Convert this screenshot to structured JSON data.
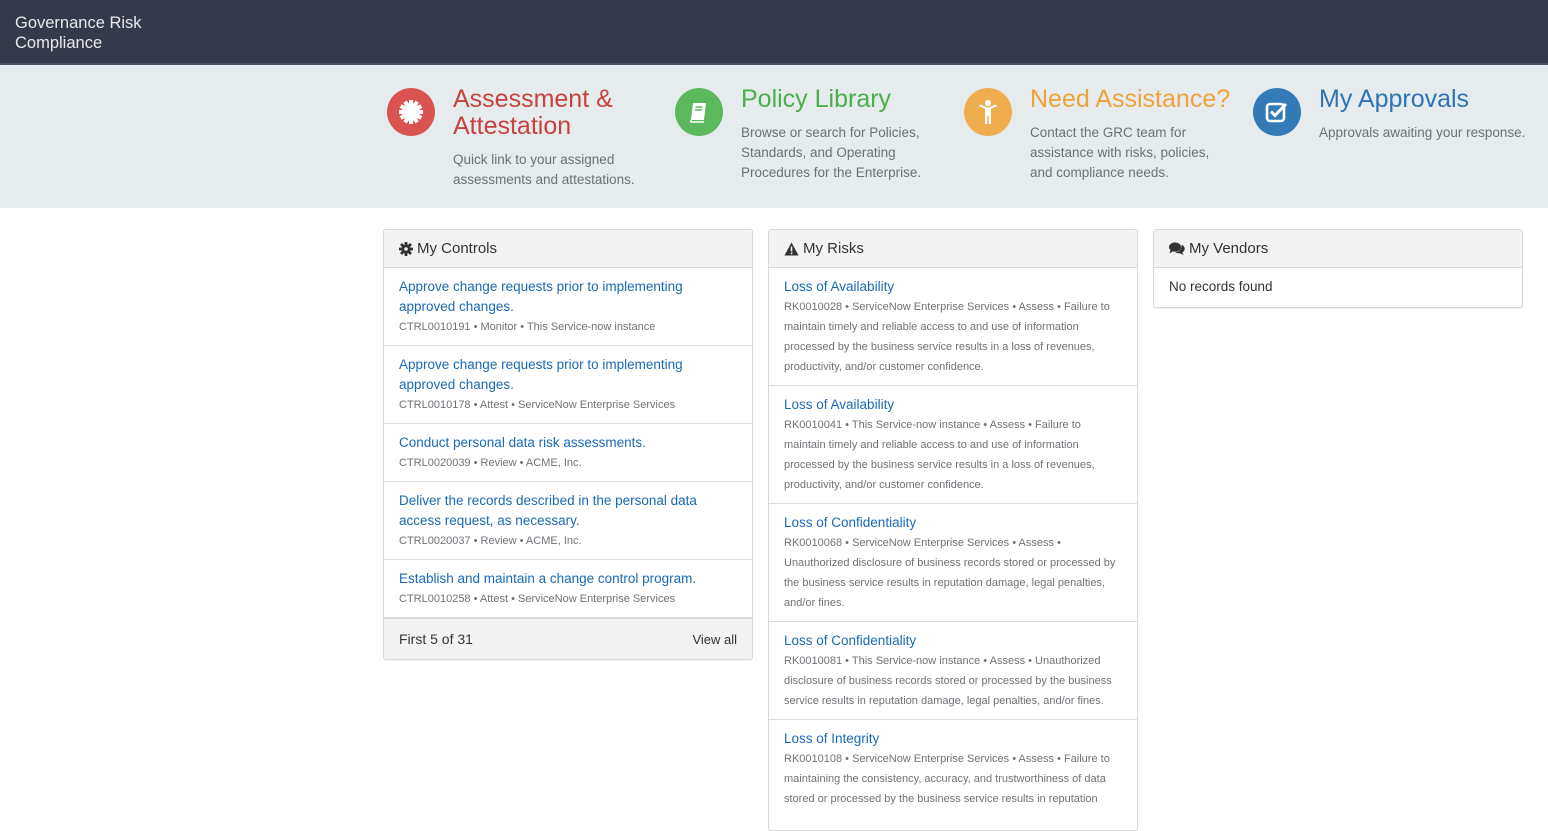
{
  "app": {
    "title": "Governance Risk Compliance"
  },
  "tiles": [
    {
      "title": "Assessment & Attestation",
      "description": "Quick link to your assigned assessments and attestations.",
      "icon": "badge-icon",
      "color": "#d9534f",
      "title_color": "#c9413d"
    },
    {
      "title": "Policy Library",
      "description": "Browse or search for Policies, Standards, and Operating Procedures for the Enterprise.",
      "icon": "book-icon",
      "color": "#5cb85c",
      "title_color": "#4cae4c"
    },
    {
      "title": "Need Assistance?",
      "description": "Contact the GRC team for assistance with risks, policies, and compliance needs.",
      "icon": "person-icon",
      "color": "#f0ad4e",
      "title_color": "#eea23b"
    },
    {
      "title": "My Approvals",
      "description": "Approvals awaiting your response.",
      "icon": "checkbox-icon",
      "color": "#337ab7",
      "title_color": "#2e73b8"
    }
  ],
  "controls": {
    "title": "My Controls",
    "items": [
      {
        "title": "Approve change requests prior to implementing approved changes.",
        "meta": "CTRL0010191 • Monitor • This Service-now instance"
      },
      {
        "title": "Approve change requests prior to implementing approved changes.",
        "meta": "CTRL0010178 • Attest • ServiceNow Enterprise Services"
      },
      {
        "title": "Conduct personal data risk assessments.",
        "meta": "CTRL0020039 • Review • ACME, Inc."
      },
      {
        "title": "Deliver the records described in the personal data access request, as necessary.",
        "meta": "CTRL0020037 • Review • ACME, Inc."
      },
      {
        "title": "Establish and maintain a change control program.",
        "meta": "CTRL0010258 • Attest • ServiceNow Enterprise Services"
      }
    ],
    "footer_count": "First 5 of 31",
    "view_all": "View all"
  },
  "risks": {
    "title": "My Risks",
    "items": [
      {
        "title": "Loss of Availability",
        "meta": "RK0010028 • ServiceNow Enterprise Services • Assess • Failure to maintain timely and reliable access to and use of information processed by the business service results in a loss of revenues, productivity, and/or customer confidence."
      },
      {
        "title": "Loss of Availability",
        "meta": "RK0010041 • This Service-now instance • Assess • Failure to maintain timely and reliable access to and use of information processed by the business service results in a loss of revenues, productivity, and/or customer confidence."
      },
      {
        "title": "Loss of Confidentiality",
        "meta": "RK0010068 • ServiceNow Enterprise Services • Assess • Unauthorized disclosure of business records stored or processed by the business service results in reputation damage, legal penalties, and/or fines."
      },
      {
        "title": "Loss of Confidentiality",
        "meta": "RK0010081 • This Service-now instance • Assess • Unauthorized disclosure of business records stored or processed by the business service results in reputation damage, legal penalties, and/or fines."
      },
      {
        "title": "Loss of Integrity",
        "meta": "RK0010108 • ServiceNow Enterprise Services • Assess • Failure to maintaining the consistency, accuracy, and trustworthiness of data stored or processed by the business service results in reputation"
      }
    ]
  },
  "vendors": {
    "title": "My Vendors",
    "empty": "No records found"
  }
}
